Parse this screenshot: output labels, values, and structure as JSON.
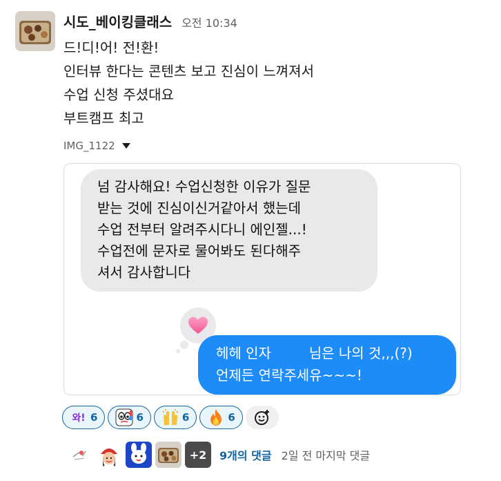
{
  "message": {
    "sender": "시도_베이킹클래스",
    "time": "오전 10:34",
    "lines": [
      "드!디!어! 전!환!",
      "인터뷰 한다는 콘텐츠 보고 진심이 느껴져서",
      "수업 신청 주셨대요",
      "부트캠프 최고"
    ],
    "file": {
      "name": "IMG_1122",
      "expand_icon": "caret-down-icon"
    }
  },
  "attachment": {
    "incoming_lines": [
      "넘 감사해요! 수업신청한 이유가 질문",
      "받는 것에 진심이신거같아서 했는데",
      "수업 전부터 알려주시다니 에인젤...!",
      "수업전에 문자로 물어봐도 된다해주",
      "셔서 감사합니다"
    ],
    "tapback_icon": "heart-icon",
    "outgoing_line1_a": "헤헤 인자",
    "outgoing_line1_b": "님은 나의 것,,,(?)",
    "outgoing_line2": "언제든 연락주세유~~~!"
  },
  "reactions": [
    {
      "emoji_name": "wa-text-icon",
      "count": "6"
    },
    {
      "emoji_name": "eyes-face-icon",
      "count": "6"
    },
    {
      "emoji_name": "raised-hands-icon",
      "count": "6"
    },
    {
      "emoji_name": "fire-icon",
      "count": "6"
    }
  ],
  "thread": {
    "more_label": "+2",
    "reply_count": "9개의 댓글",
    "last_reply": "2일 전 마지막 댓글"
  },
  "colors": {
    "link_blue": "#1264a3",
    "imessage_blue": "#1d8cf8",
    "imessage_gray": "#e9e9eb",
    "reaction_bg": "#e8f5fa"
  }
}
